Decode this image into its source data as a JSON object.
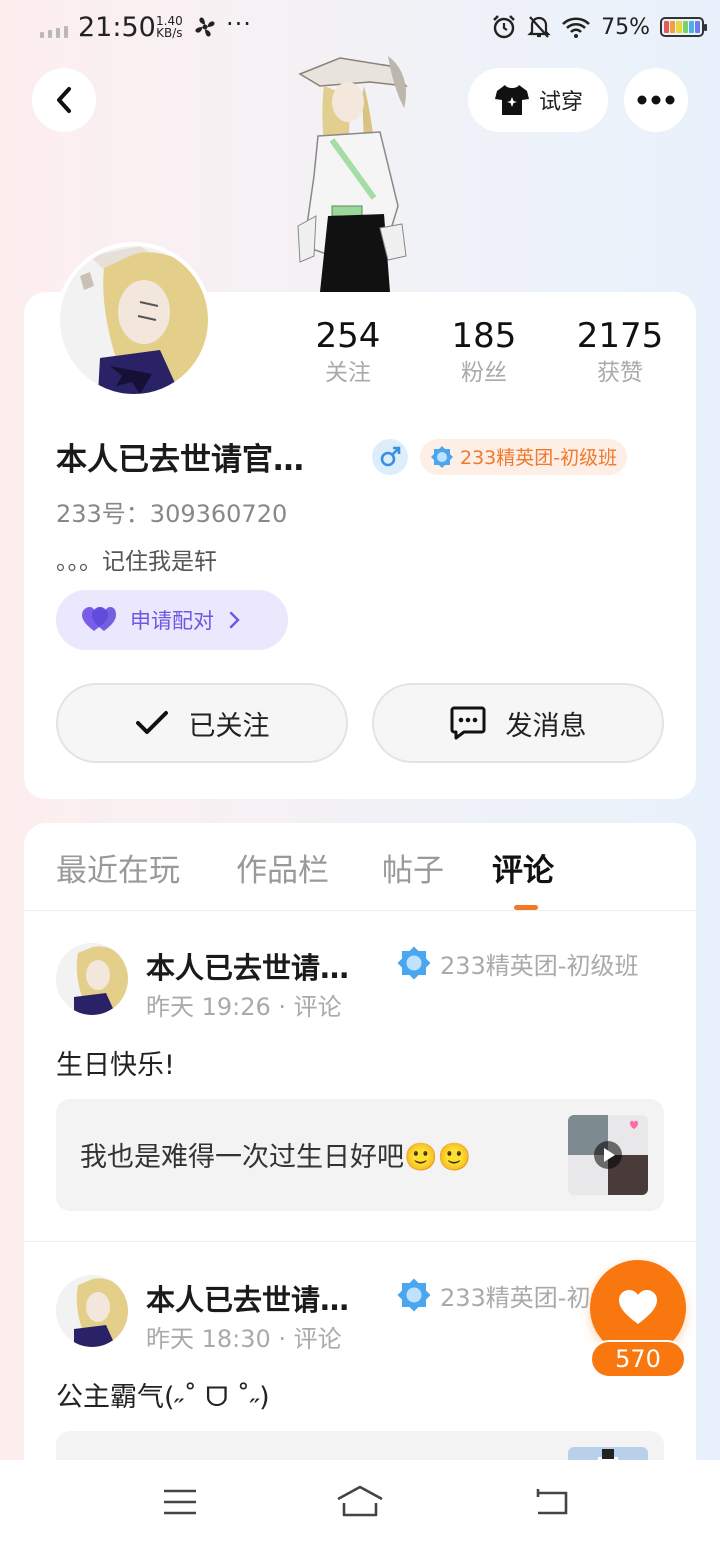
{
  "status_bar": {
    "time": "21:50",
    "net_speed_value": "1.40",
    "net_speed_unit": "KB/s",
    "more": "···",
    "battery_pct": "75%"
  },
  "header": {
    "tryon_label": "试穿"
  },
  "profile": {
    "stats": [
      {
        "value": "254",
        "label": "关注"
      },
      {
        "value": "185",
        "label": "粉丝"
      },
      {
        "value": "2175",
        "label": "获赞"
      }
    ],
    "username": "本人已去世请官…",
    "gender_icon": "male-symbol",
    "rank": "233精英团-初级班",
    "uid": "233号：309360720",
    "bio": "。。。记住我是轩",
    "pair_label": "申请配对",
    "follow_label": "已关注",
    "message_label": "发消息"
  },
  "tabs": [
    {
      "label": "最近在玩"
    },
    {
      "label": "作品栏"
    },
    {
      "label": "帖子"
    },
    {
      "label": "评论"
    }
  ],
  "active_tab": "评论",
  "posts": [
    {
      "author": "本人已去世请…",
      "badge": "233精英团-初级班",
      "meta": "昨天 19:26 · 评论",
      "text": "生日快乐!",
      "quote": "我也是难得一次过生日好吧🙂🙂"
    },
    {
      "author": "本人已去世请…",
      "badge": "233精英团-初级班",
      "meta": "昨天 18:30 · 评论",
      "text": "公主霸气(˶˚ ᗜ ˚˶)"
    }
  ],
  "like": {
    "count": "570"
  },
  "colors": {
    "accent": "#f9770f",
    "pair": "#6d57e3",
    "rank": "#f07a2c"
  }
}
